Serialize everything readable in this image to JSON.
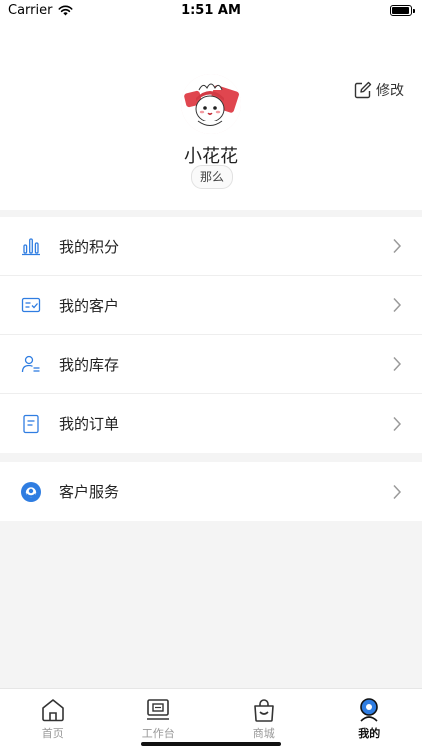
{
  "status_bar": {
    "carrier": "Carrier",
    "time": "1:51 AM"
  },
  "profile": {
    "edit_label": "修改",
    "username": "小花花",
    "tag": "那么"
  },
  "menu": {
    "items": [
      {
        "label": "我的积分",
        "icon": "bar-chart-icon"
      },
      {
        "label": "我的客户",
        "icon": "id-card-check-icon"
      },
      {
        "label": "我的库存",
        "icon": "person-list-icon"
      },
      {
        "label": "我的订单",
        "icon": "document-icon"
      }
    ],
    "service": {
      "label": "客户服务",
      "icon": "customer-service-icon"
    }
  },
  "tabs": [
    {
      "label": "首页",
      "icon": "home-icon",
      "active": false
    },
    {
      "label": "工作台",
      "icon": "workbench-icon",
      "active": false
    },
    {
      "label": "商城",
      "icon": "shopping-bag-icon",
      "active": false
    },
    {
      "label": "我的",
      "icon": "profile-icon",
      "active": true
    }
  ],
  "colors": {
    "accent": "#2f7de1",
    "active_tab": "#111111",
    "inactive_tab": "#999999"
  }
}
